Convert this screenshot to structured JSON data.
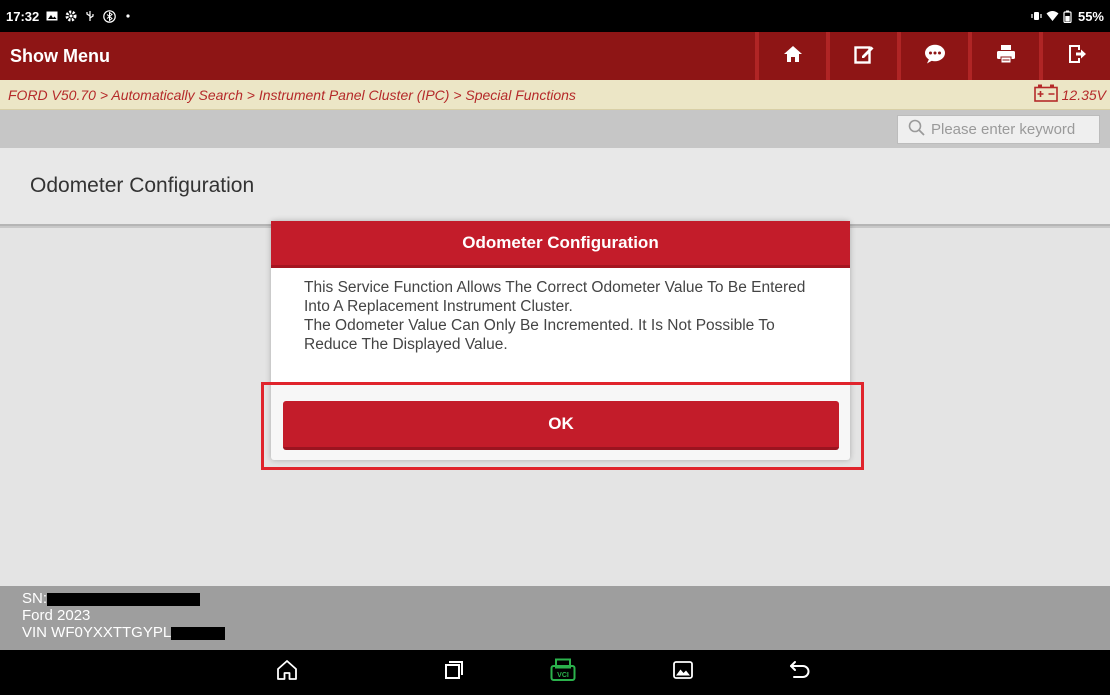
{
  "status_bar": {
    "time": "17:32",
    "battery_percent": "55%",
    "icons_left": [
      "image-icon",
      "gear-icon",
      "usb-icon",
      "bluetooth-icon",
      "dot-icon"
    ],
    "icons_right": [
      "vibrate-icon",
      "wifi-icon",
      "battery-icon"
    ]
  },
  "header": {
    "title": "Show Menu",
    "tools": [
      "home-icon",
      "edit-icon",
      "chat-icon",
      "print-icon",
      "exit-icon"
    ]
  },
  "breadcrumb": {
    "path": "FORD V50.70 > Automatically Search > Instrument Panel Cluster (IPC) > Special Functions",
    "voltage": "12.35V"
  },
  "search": {
    "placeholder": "Please enter keyword"
  },
  "list": {
    "heading": "Odometer Configuration"
  },
  "footer": {
    "sn_label": "SN:",
    "vehicle": "Ford  2023",
    "vin_label": "VIN WF0YXXTTGYPL"
  },
  "dialog": {
    "title": "Odometer Configuration",
    "body_line1": "This Service Function Allows The Correct Odometer Value To Be Entered Into A Replacement Instrument Cluster.",
    "body_line2": "The Odometer Value Can Only Be Incremented. It Is Not Possible To Reduce The Displayed Value.",
    "ok_label": "OK"
  },
  "navbar": {
    "buttons": [
      "home-icon",
      "recent-apps-icon",
      "vci-icon",
      "gallery-icon",
      "back-icon"
    ]
  },
  "colors": {
    "header": "#8e1515",
    "dialog_red": "#c31c2a",
    "breadcrumb_bg": "#ece6c6",
    "breadcrumb_text": "#b52a2a",
    "vci_green": "#2bb24c"
  }
}
